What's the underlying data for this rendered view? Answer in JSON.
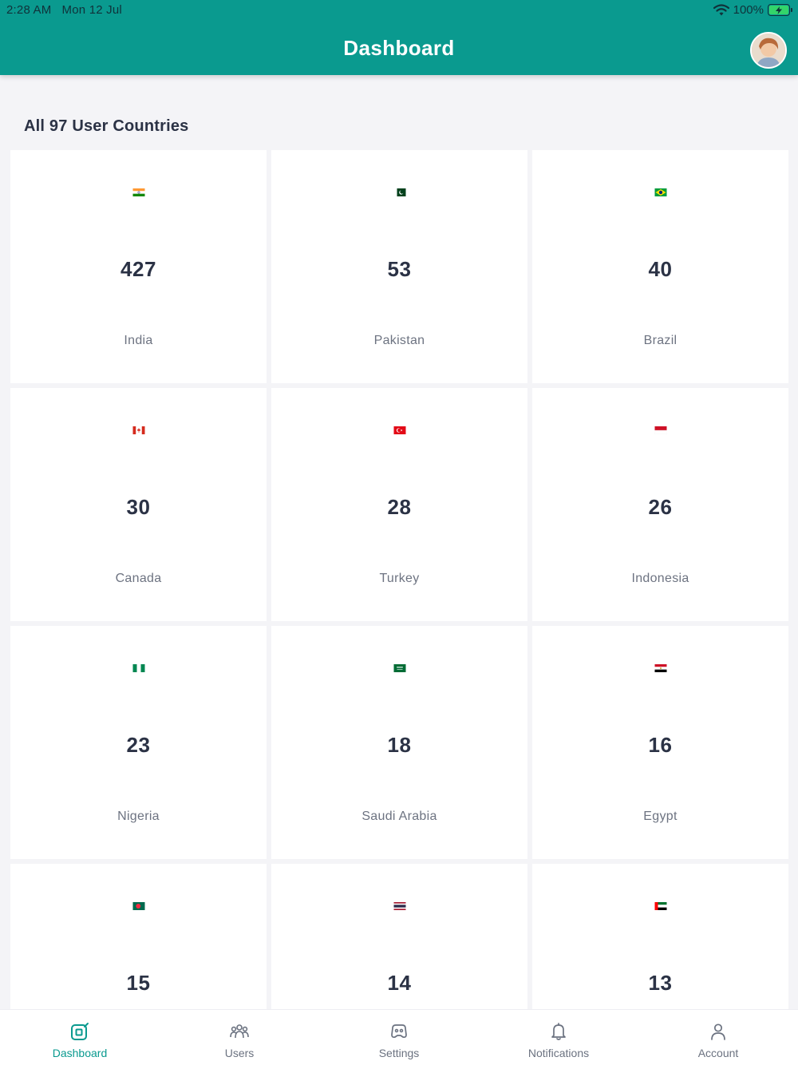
{
  "status_bar": {
    "time": "2:28 AM",
    "date": "Mon 12 Jul",
    "battery": "100%"
  },
  "header": {
    "title": "Dashboard"
  },
  "section": {
    "title": "All 97 User Countries"
  },
  "countries": [
    {
      "count": "427",
      "name": "India"
    },
    {
      "count": "53",
      "name": "Pakistan"
    },
    {
      "count": "40",
      "name": "Brazil"
    },
    {
      "count": "30",
      "name": "Canada"
    },
    {
      "count": "28",
      "name": "Turkey"
    },
    {
      "count": "26",
      "name": "Indonesia"
    },
    {
      "count": "23",
      "name": "Nigeria"
    },
    {
      "count": "18",
      "name": "Saudi Arabia"
    },
    {
      "count": "16",
      "name": "Egypt"
    },
    {
      "count": "15",
      "name": ""
    },
    {
      "count": "14",
      "name": ""
    },
    {
      "count": "13",
      "name": ""
    }
  ],
  "tabs": [
    {
      "label": "Dashboard",
      "icon": "dashboard-icon",
      "active": true
    },
    {
      "label": "Users",
      "icon": "users-icon",
      "active": false
    },
    {
      "label": "Settings",
      "icon": "settings-icon",
      "active": false
    },
    {
      "label": "Notifications",
      "icon": "bell-icon",
      "active": false
    },
    {
      "label": "Account",
      "icon": "account-icon",
      "active": false
    }
  ],
  "colors": {
    "brand": "#0a9a8f",
    "text": "#2b3245",
    "muted": "#6d7381",
    "background": "#f4f4f7"
  }
}
